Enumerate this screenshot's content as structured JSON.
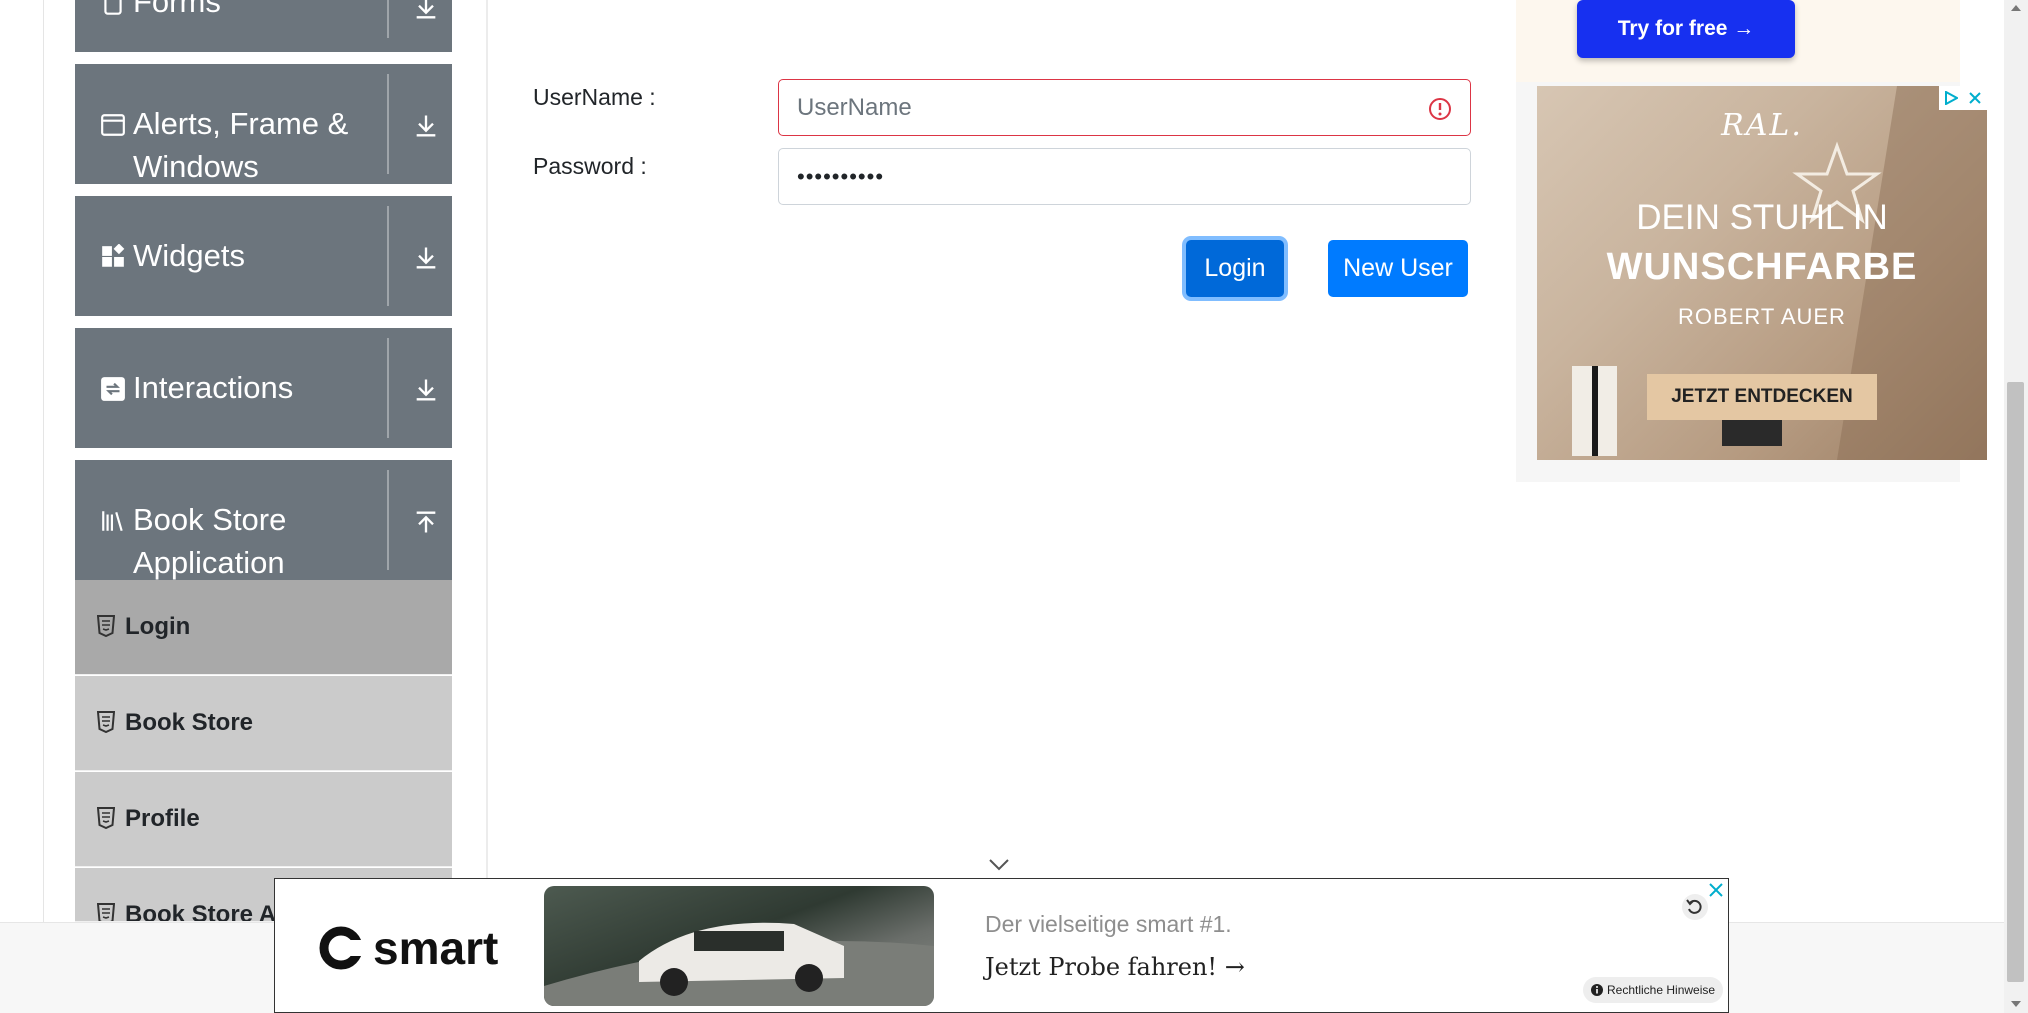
{
  "sidebar": {
    "groups": [
      {
        "label": "Forms",
        "icon": "forms-icon",
        "arrow": "download-arrow-icon"
      },
      {
        "label": "Alerts, Frame & Windows",
        "icon": "window-icon",
        "arrow": "download-arrow-icon"
      },
      {
        "label": "Widgets",
        "icon": "widgets-icon",
        "arrow": "download-arrow-icon"
      },
      {
        "label": "Interactions",
        "icon": "interactions-icon",
        "arrow": "download-arrow-icon"
      },
      {
        "label": "Book Store Application",
        "icon": "books-icon",
        "arrow": "upload-arrow-icon"
      }
    ],
    "bookstore_items": [
      {
        "label": "Login",
        "active": true
      },
      {
        "label": "Book Store"
      },
      {
        "label": "Profile"
      },
      {
        "label": "Book Store API"
      }
    ]
  },
  "login_form": {
    "username_label": "UserName :",
    "username_placeholder": "UserName",
    "username_value": "",
    "username_state": "invalid",
    "password_label": "Password :",
    "password_value": "••••••••••",
    "login_button": "Login",
    "new_user_button": "New User"
  },
  "ads": {
    "try_free": "Try for free →",
    "ral": {
      "logo": "RAL.",
      "line1": "DEIN STUHL IN",
      "line2": "WUNSCHFARBE",
      "line3": "ROBERT AUER",
      "cta": "JETZT ENTDECKEN"
    },
    "smart": {
      "logo": "smart",
      "line1": "Der vielseitige smart #1.",
      "line2": "Jetzt Probe fahren! →",
      "legal": "Rechtliche Hinweise"
    }
  },
  "colors": {
    "sidebar_group": "#6c757d",
    "sidebar_item": "#cbcbcb",
    "sidebar_item_active": "#a9a9a9",
    "primary": "#007bff",
    "invalid": "#dc3545"
  }
}
